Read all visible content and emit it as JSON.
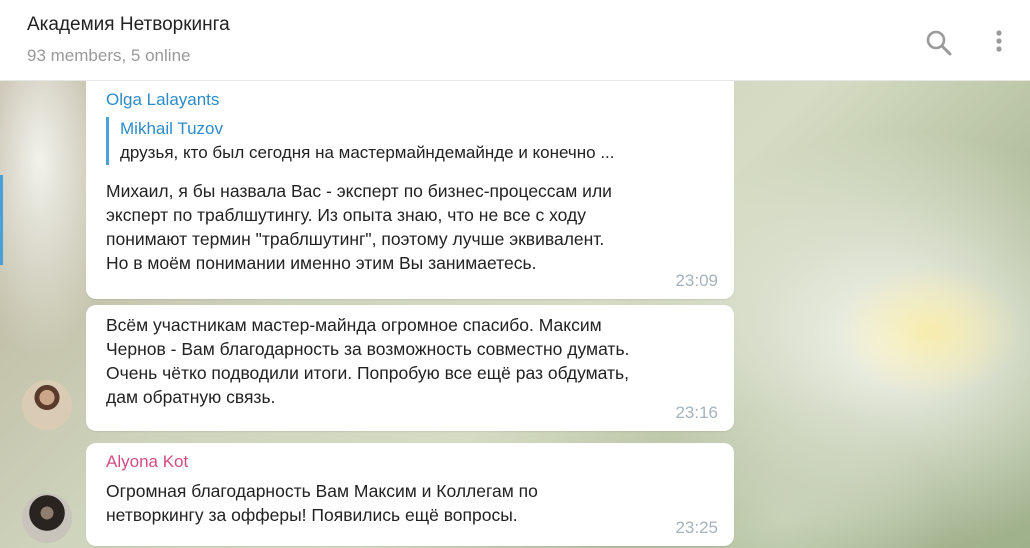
{
  "header": {
    "title": "Академия Нетворкинга",
    "subtitle": "93 members, 5 online",
    "search_icon": "search-icon",
    "menu_icon": "kebab-menu-icon"
  },
  "messages": [
    {
      "sender": "Olga Lalayants",
      "reply": {
        "name": "Mikhail Tuzov",
        "text": "друзья, кто был сегодня на мастермайндемайнде и конечно ..."
      },
      "text": "Михаил, я бы назвала Вас - эксперт по бизнес-процессам или\nэксперт по траблшутингу. Из опыта знаю, что не все с ходу\nпонимают термин \"траблшутинг\", поэтому лучше эквивалент.\nНо в моём понимании именно этим Вы занимаетесь.",
      "time": "23:09"
    },
    {
      "text": "Всём участникам мастер-майнда огромное спасибо. Максим\nЧернов - Вам благодарность за возможность совместно думать.\nОчень чётко подводили итоги. Попробую все ещё раз обдумать,\nдам обратную связь.",
      "time": "23:16"
    },
    {
      "sender": "Alyona Kot",
      "text": "Огромная благодарность Вам Максим и Коллегам по\nнетворкингу за офферы! Появились ещё вопросы.",
      "time": "23:25"
    }
  ],
  "colors": {
    "sender_blue": "#2e8bc8",
    "sender_pink": "#d24c85",
    "time_gray": "#a6b3bd",
    "reply_bar": "#4aa2d8"
  }
}
